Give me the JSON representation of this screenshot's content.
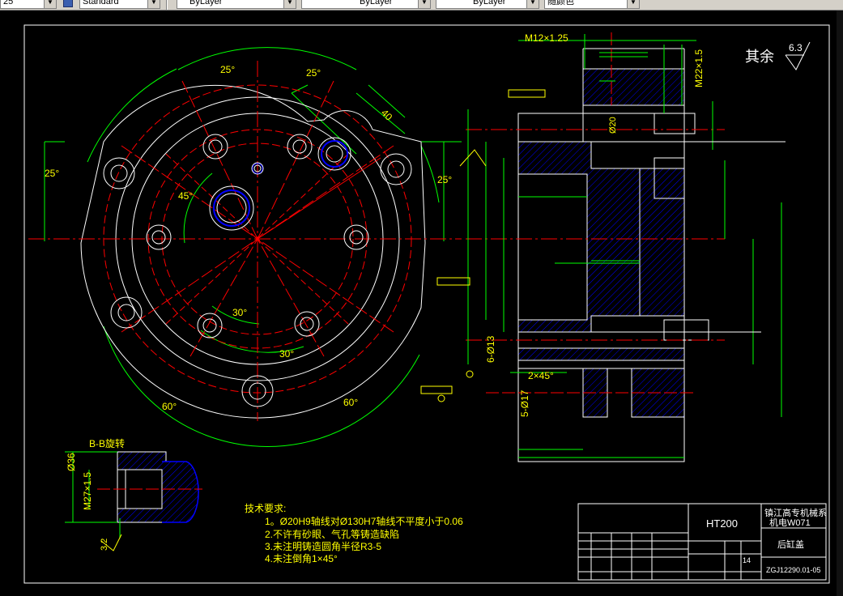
{
  "toolbar": {
    "combo_1": "25",
    "combo_2": "Standard",
    "combo_3": "ByLayer",
    "combo_4": "ByLayer",
    "combo_5": "ByLayer",
    "combo_6": "随颜色"
  },
  "drawing": {
    "surface_finish_label": "其余",
    "surface_finish_value": "6.3",
    "dim_m12": "M12×1.25",
    "dim_m22": "M22×1.5",
    "dim_d20": "Ø20",
    "dim_d13": "6-Ø13",
    "dim_d17": "5-Ø17",
    "dim_chamfer": "2×45°",
    "dim_d36": "Ø36",
    "dim_m27": "M27×1.5",
    "dim_32": "3.2",
    "dim_40": "40",
    "angle_25_a": "25°",
    "angle_25_b": "25°",
    "angle_25_c": "25°",
    "angle_25_d": "25°",
    "angle_45": "45°",
    "angle_30_a": "30°",
    "angle_30_b": "30°",
    "angle_60_a": "60°",
    "angle_60_b": "60°",
    "section_label": "B-B旋转",
    "notes_title": "技术要求:",
    "notes": [
      "1。Ø20H9轴线对Ø130H7轴线不平度小于0.06",
      "2.不许有砂眼、气孔等铸造缺陷",
      "3.未注明铸造圆角半径R3-5",
      "4.未注倒角1×45°"
    ],
    "title_material": "HT200",
    "title_school_1": "镇江高专机械系",
    "title_school_2": "机电W071",
    "title_part": "后缸盖",
    "title_drawing_no": "ZGJ12290.01-05",
    "title_scale": "14"
  },
  "colors": {
    "background": "#000000",
    "white": "#ffffff",
    "yellow": "#ffff00",
    "green": "#00ff00",
    "red": "#ff0000",
    "blue": "#0000ff",
    "toolbar": "#d4d0c8"
  }
}
